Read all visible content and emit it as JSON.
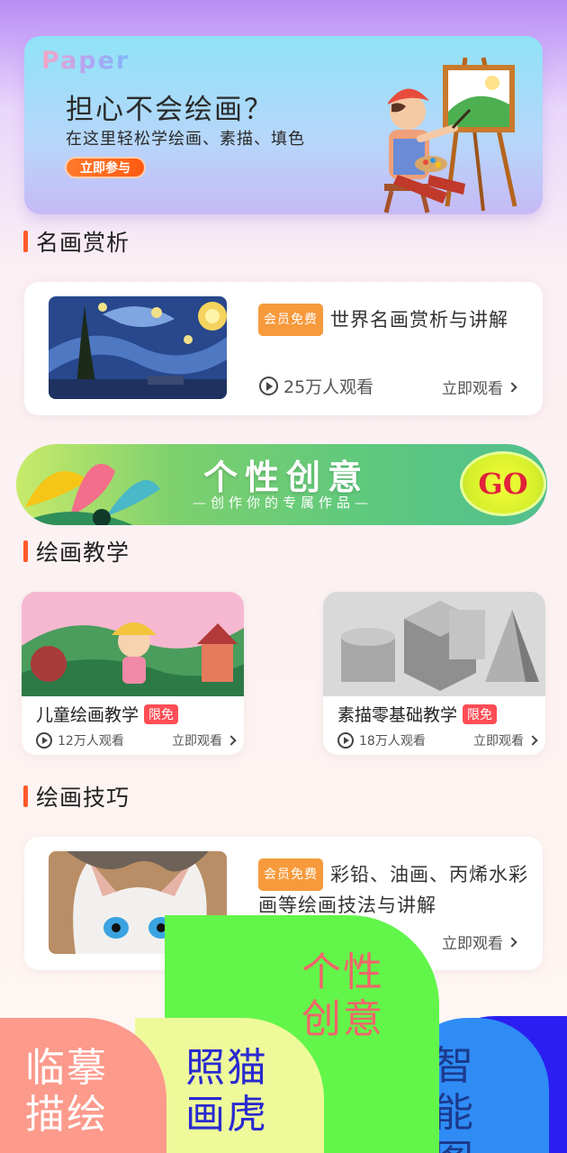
{
  "hero": {
    "brand": "Paper",
    "title": "担心不会绘画？",
    "subtitle": "在这里轻松学绘画、素描、填色",
    "cta": "立即参与"
  },
  "sections": {
    "appreciation": "名画赏析",
    "teaching": "绘画教学",
    "skills": "绘画技巧"
  },
  "appreciation_card": {
    "badge": "会员免费",
    "title": "世界名画赏析与讲解",
    "views": "25万人观看",
    "watch": "立即观看"
  },
  "creative_banner": {
    "title": "个性创意",
    "subtitle": "—创作你的专属作品—",
    "go": "GO"
  },
  "teaching_cards": [
    {
      "title": "儿童绘画教学",
      "badge": "限免",
      "views": "12万人观看",
      "watch": "立即观看"
    },
    {
      "title": "素描零基础教学",
      "badge": "限免",
      "views": "18万人观看",
      "watch": "立即观看"
    }
  ],
  "skills_card": {
    "badge": "会员免费",
    "title": "彩铅、油画、丙烯水彩画等绘画技法与讲解",
    "watch": "立即观看"
  },
  "bottom_nav": {
    "item1": "临摹描绘",
    "item2": "照猫画虎",
    "item3": "个性创意",
    "item4": "智能图"
  },
  "colors": {
    "accent": "#ff5a2b",
    "badge_orange": "#f79a3c",
    "badge_red": "#ff4d55",
    "nav1": "#fc9a8c",
    "nav2": "#eefa9a",
    "nav3": "#62f54a",
    "nav4": "#2f8cf5",
    "nav5": "#2a1ff0"
  }
}
